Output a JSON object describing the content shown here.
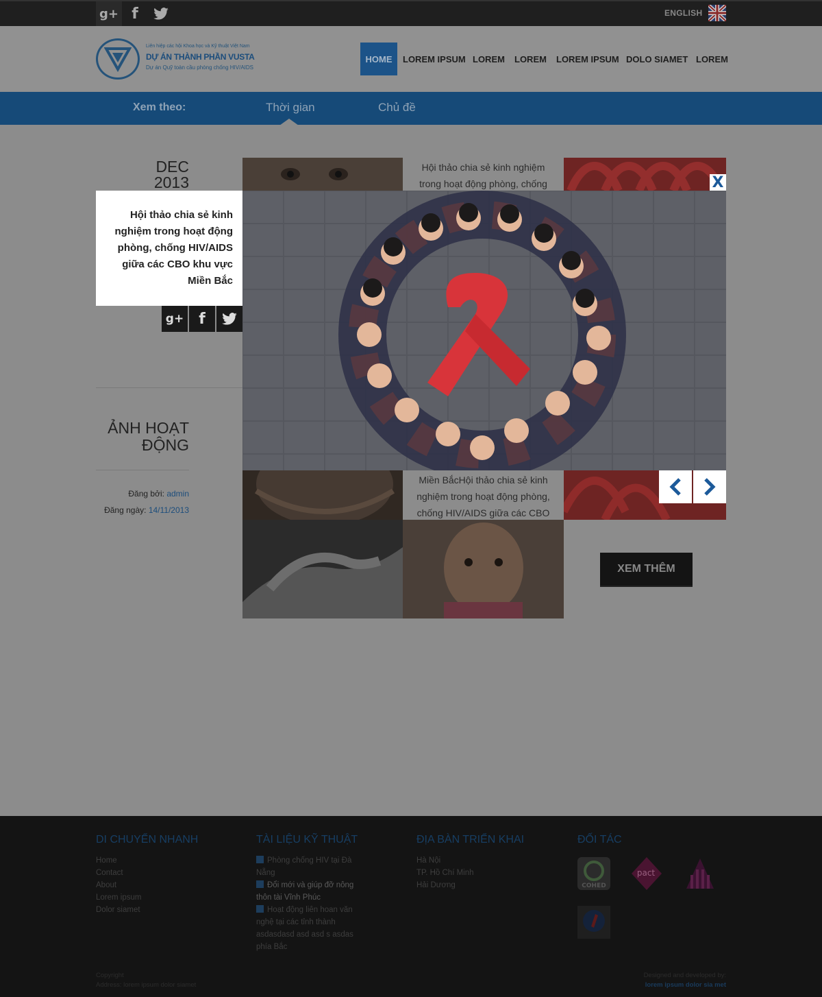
{
  "topbar": {
    "social": [
      "google-plus-icon",
      "facebook-icon",
      "twitter-icon"
    ],
    "social_glyphs": [
      "g+",
      "f",
      "t"
    ],
    "language": "ENGLISH",
    "flag": "uk-flag-icon"
  },
  "header": {
    "logo_line1": "Liên hiệp các hội Khoa học và Kỹ thuật Việt Nam",
    "logo_line2": "DỰ ÁN THÀNH PHẦN VUSTA",
    "logo_line3": "Dự án Quỹ toàn cầu phòng chống HIV/AIDS",
    "nav": [
      "HOME",
      "LOREM IPSUM",
      "LOREM",
      "LOREM",
      "LOREM IPSUM",
      "DOLO SIAMET",
      "LOREM"
    ],
    "active_nav": "HOME"
  },
  "filter": {
    "label": "Xem theo:",
    "tabs": [
      "Thời gian",
      "Chủ đề"
    ],
    "active_tab": "Thời gian"
  },
  "post": {
    "month": "DEC",
    "year": "2013",
    "title": "Hội thảo chia sẻ kinh nghiệm trong hoạt động phòng, chống HIV/AIDS giữa các CBO khu vực Miền Bắc",
    "share": [
      "google-plus-icon",
      "facebook-icon",
      "twitter-icon"
    ],
    "share_glyphs": [
      "g+",
      "f",
      "t"
    ]
  },
  "album": {
    "title": "ẢNH HOẠT ĐỘNG",
    "posted_by_label": "Đăng bởi:",
    "posted_by": "admin",
    "posted_date_label": "Đăng ngày:",
    "posted_date": "14/11/2013"
  },
  "grid": {
    "text_top": "Hội thảo chia sẻ kinh nghiệm trong hoạt động phòng, chống",
    "text_mid": "Miền BắcHội thảo chia sẻ kinh nghiệm trong hoạt động phòng, chống HIV/AIDS giữa các CBO",
    "more_button": "XEM THÊM"
  },
  "lightbox": {
    "close_label": "X",
    "prev_icon": "chevron-left-icon",
    "next_icon": "chevron-right-icon"
  },
  "footer": {
    "col1": {
      "title": "DI CHUYỂN NHANH",
      "items": [
        "Home",
        "Contact",
        "About",
        "Lorem ipsum",
        "Dolor siamet"
      ]
    },
    "col2": {
      "title": "TÀI LIỆU KỸ THUẬT",
      "items": [
        "Phòng chống HIV tại Đà Nẵng",
        "Đổi mới và giúp đỡ nông thôn tài Vĩnh Phúc",
        "Hoạt động liên hoan văn nghệ tại các tỉnh thành asdasdasd asd asd s asdas phía Bắc"
      ]
    },
    "col3": {
      "title": "ĐỊA BÀN TRIỂN KHAI",
      "items": [
        "Hà Nội",
        "TP. Hồ Chí Minh",
        "Hải Dương"
      ]
    },
    "col4": {
      "title": "ĐỐI TÁC",
      "partners": [
        "COHED",
        "pact",
        "ISDS-logo",
        "partner-ribbon-logo"
      ]
    },
    "copyright": "Copyright",
    "address": "Address: lorem ipsum dolor siamet",
    "designed_by_label": "Designed and developed by:",
    "designed_by": "lorem ipsum dolor sia met"
  },
  "colors": {
    "accent": "#1c5388",
    "footer_bg": "#141414",
    "overlay_bg": "#8c8c8c"
  }
}
